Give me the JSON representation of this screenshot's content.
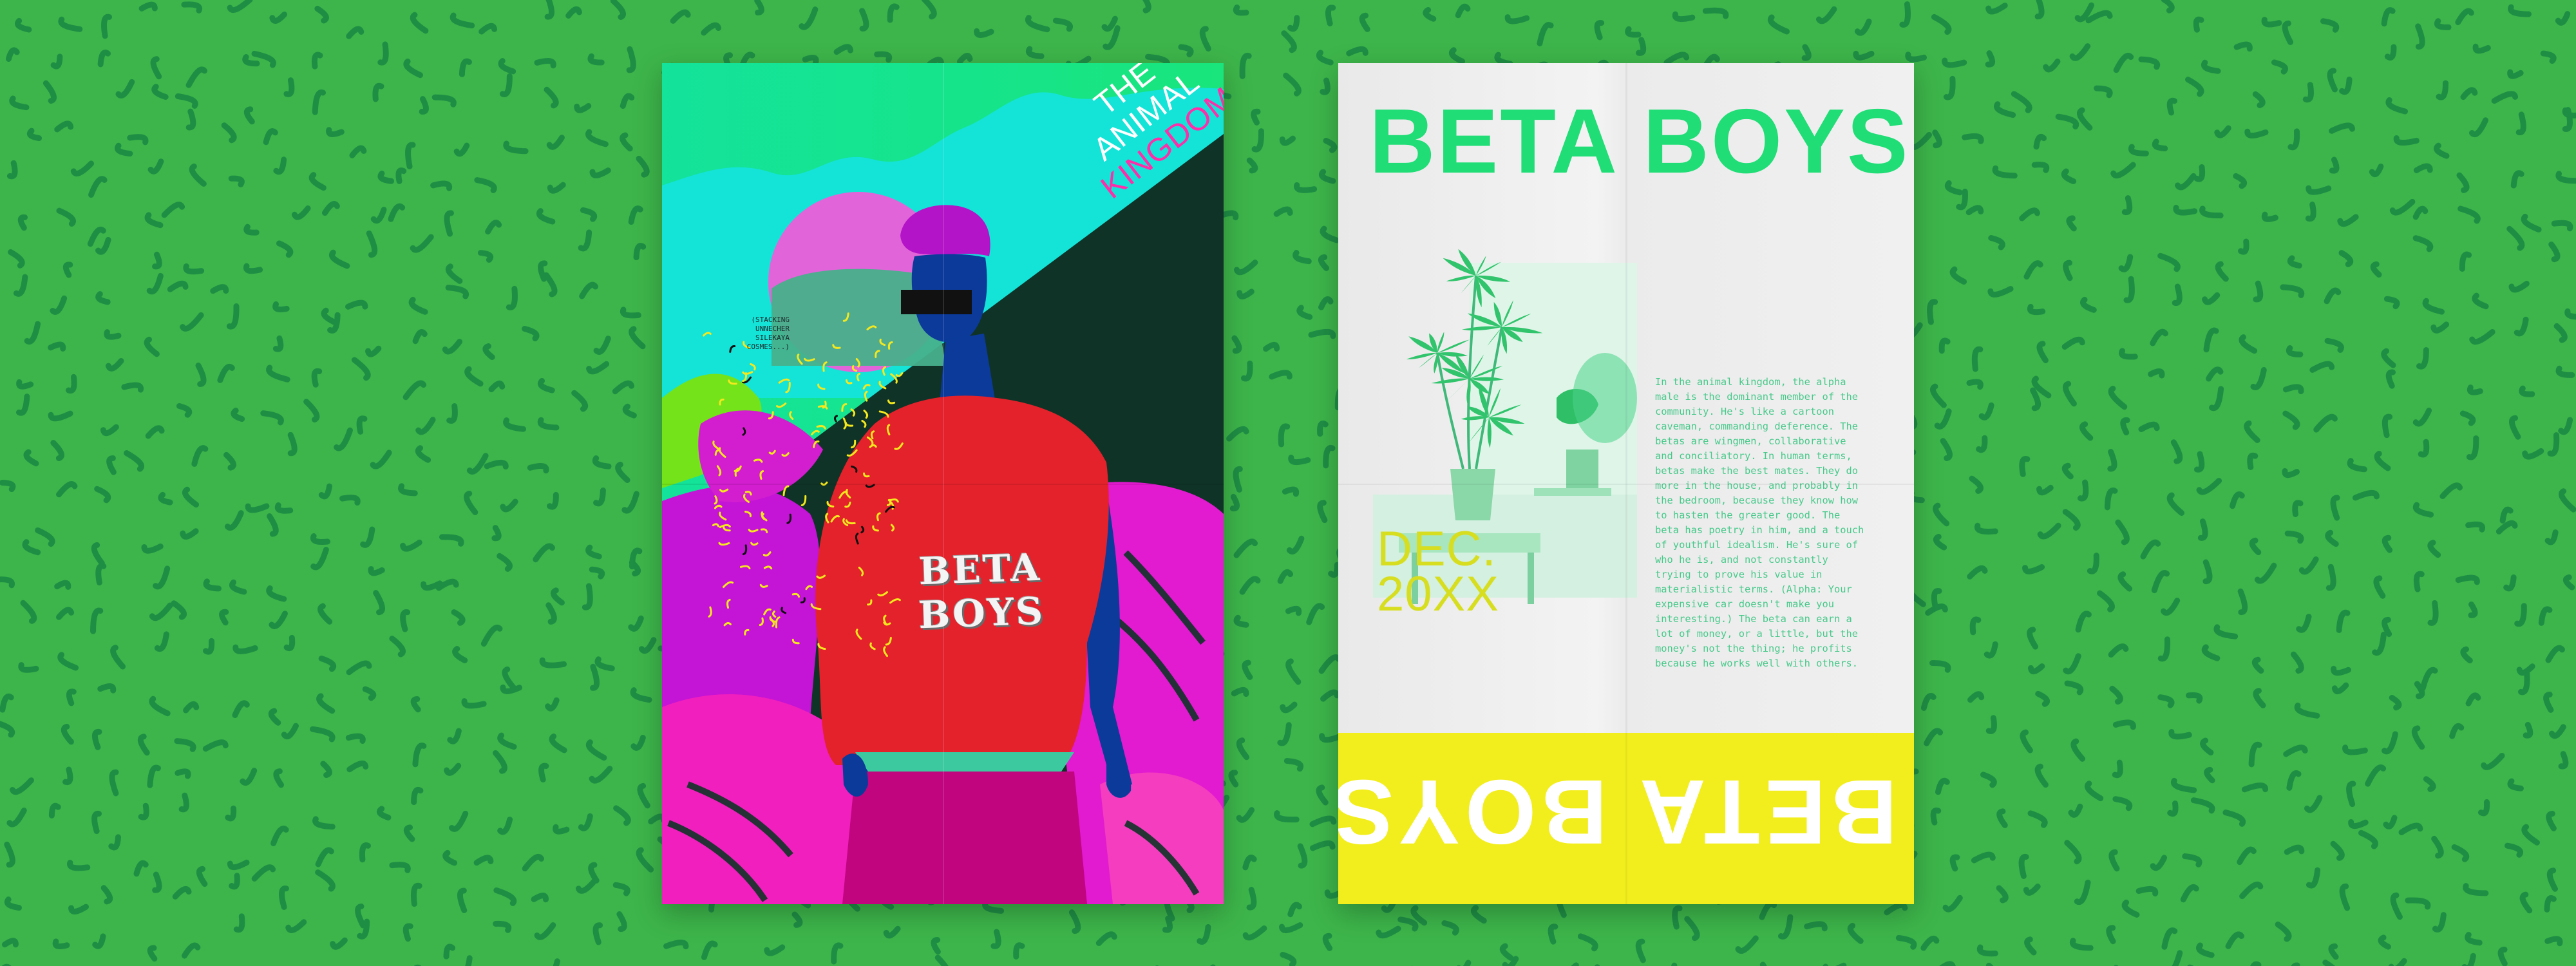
{
  "colors": {
    "background": "#3db54a",
    "squiggle": "#1f8e45",
    "brand_green": "#20dd76",
    "yellow": "#f2ee1e",
    "magenta": "#ff2ea8",
    "shirt_red": "#e3222b",
    "skin_blue": "#0b3a9a"
  },
  "left_poster": {
    "title_line1": "THE",
    "title_line2": "ANIMAL",
    "title_line3": "KINGDOM",
    "small_note": "(STACKING\nUNNECHER\nSILEKAYA\nCOSMES...)",
    "shirt_text": "BETA BOYS",
    "figure_icon": "man-figure-icon",
    "censor_icon": "censor-bar-icon"
  },
  "right_poster": {
    "title": "BETA BOYS",
    "date": "DEC.\n20XX",
    "body": "In the animal kingdom, the alpha male is the dominant member of the community. He's like a cartoon caveman, commanding deference. The betas are wingmen, collaborative and conciliatory. In human terms, betas make the best mates. They do more in the house, and probably in the bedroom, because they know how to hasten the greater good. The beta has poetry in him, and a touch of youthful idealism. He's sure of who he is, and not constantly trying to prove his value in materialistic terms. (Alpha: Your expensive car doesn't make you interesting.) The beta can earn a lot of money, or a little, but the money's not the thing; he profits because he works well with others.",
    "band_title": "BETA BOYS",
    "plant_icon": "plant-photo-icon"
  }
}
